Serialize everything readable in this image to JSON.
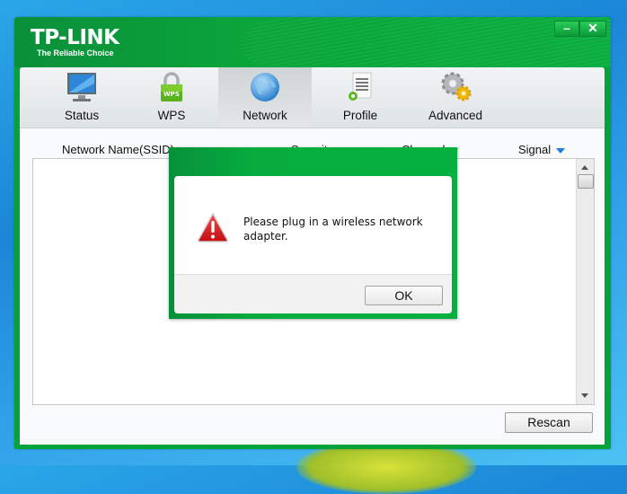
{
  "window": {
    "brand": "TP-LINK",
    "tagline": "The Reliable Choice",
    "controls": {
      "minimize": "–",
      "close": "✕"
    }
  },
  "tabs": [
    {
      "label": "Status",
      "icon": "monitor-icon",
      "active": false
    },
    {
      "label": "WPS",
      "icon": "wps-lock-icon",
      "active": false
    },
    {
      "label": "Network",
      "icon": "globe-icon",
      "active": true
    },
    {
      "label": "Profile",
      "icon": "profile-document-icon",
      "active": false
    },
    {
      "label": "Advanced",
      "icon": "gears-icon",
      "active": false
    }
  ],
  "network_list": {
    "columns": [
      {
        "label": "Network Name(SSID)",
        "sort": "none"
      },
      {
        "label": "Security",
        "sort": "none"
      },
      {
        "label": "Channel",
        "sort": "none"
      },
      {
        "label": "Signal",
        "sort": "descending"
      }
    ],
    "rows": []
  },
  "rescan_label": "Rescan",
  "dialog": {
    "icon": "warning-icon",
    "message": "Please plug in a wireless network adapter.",
    "ok_label": "OK"
  },
  "colors": {
    "brand_green": "#04a33a",
    "sort_active": "#1a7fe0",
    "warning_red": "#d8121a"
  }
}
